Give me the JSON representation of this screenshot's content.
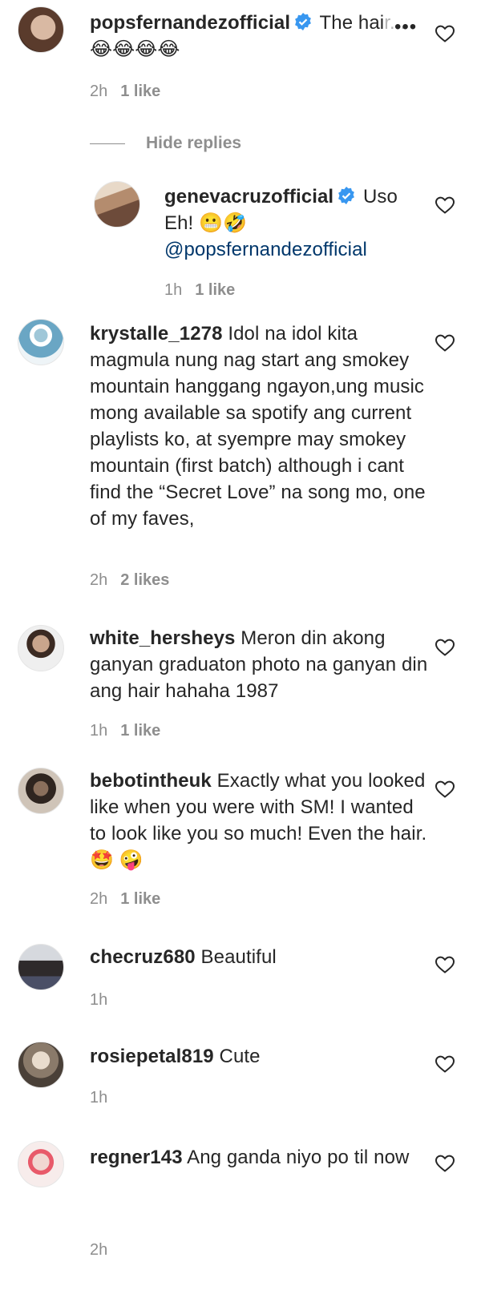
{
  "comments": [
    {
      "username": "popsfernandezofficial",
      "verified": true,
      "text": "The hai",
      "text_faded": "r...",
      "emoji_line": "😂😂😂😂",
      "time": "2h",
      "likes": "1 like"
    },
    {
      "username": "genevacruzofficial",
      "verified": true,
      "text": "Uso Eh! 😬🤣",
      "mention": "@popsfernandezofficial",
      "time": "1h",
      "likes": "1 like"
    },
    {
      "username": "krystalle_1278",
      "verified": false,
      "text": "Idol na idol kita magmula nung nag start ang smokey mountain hanggang ngayon,ung music mong available sa spotify ang current playlists ko, at syempre may smokey mountain (first batch) although i cant find the “Secret Love” na song mo, one of my faves,",
      "time": "2h",
      "likes": "2 likes"
    },
    {
      "username": "white_hersheys",
      "verified": false,
      "text": "Meron din akong ganyan graduaton photo na ganyan din ang hair hahaha 1987",
      "time": "1h",
      "likes": "1 like"
    },
    {
      "username": "bebotintheuk",
      "verified": false,
      "text": "Exactly what you looked like when you were with SM! I wanted to look like you so much! Even the hair. 🤩 🤪",
      "time": "2h",
      "likes": "1 like"
    },
    {
      "username": "checruz680",
      "verified": false,
      "text": "Beautiful",
      "time": "1h",
      "likes": ""
    },
    {
      "username": "rosiepetal819",
      "verified": false,
      "text": "Cute",
      "time": "1h",
      "likes": ""
    },
    {
      "username": "regner143",
      "verified": false,
      "text": "Ang ganda niyo po til now",
      "time": "2h",
      "likes": ""
    }
  ],
  "replies_toggle": "Hide replies",
  "icons": {
    "like": "heart-outline-icon",
    "verified": "verified-badge-icon",
    "more": "more-options-icon"
  },
  "colors": {
    "verified": "#3897f0",
    "meta": "#8e8e8e",
    "mention": "#00376b"
  }
}
